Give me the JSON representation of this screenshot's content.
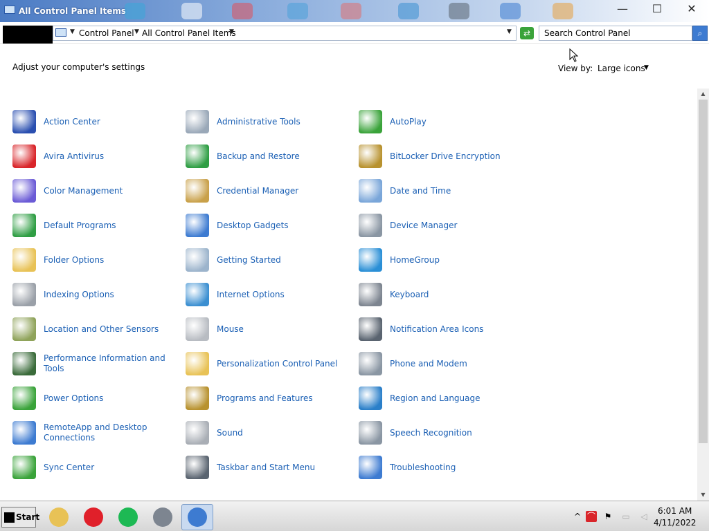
{
  "window": {
    "title": "All Control Panel Items",
    "controls": {
      "minimize": "—",
      "maximize": "☐",
      "close": "✕"
    }
  },
  "address": {
    "breadcrumb": [
      "Control Panel",
      "All Control Panel Items"
    ],
    "search_placeholder": "Search Control Panel"
  },
  "content": {
    "heading": "Adjust your computer's settings",
    "view_by_label": "View by:",
    "view_by_value": "Large icons",
    "items": [
      [
        {
          "label": "Action Center",
          "icon": "flag-icon",
          "color": "#2a4fb0"
        },
        {
          "label": "Administrative Tools",
          "icon": "tools-icon",
          "color": "#9aa8b8"
        },
        {
          "label": "AutoPlay",
          "icon": "autoplay-icon",
          "color": "#3aa33a"
        }
      ],
      [
        {
          "label": "Avira Antivirus",
          "icon": "avira-icon",
          "color": "#d9252a"
        },
        {
          "label": "Backup and Restore",
          "icon": "backup-icon",
          "color": "#2f9e44"
        },
        {
          "label": "BitLocker Drive Encryption",
          "icon": "bitlocker-icon",
          "color": "#b8922f"
        }
      ],
      [
        {
          "label": "Color Management",
          "icon": "color-icon",
          "color": "#6b5bd6"
        },
        {
          "label": "Credential Manager",
          "icon": "credential-icon",
          "color": "#c9a14a"
        },
        {
          "label": "Date and Time",
          "icon": "clock-icon",
          "color": "#7aa6d9"
        }
      ],
      [
        {
          "label": "Default Programs",
          "icon": "default-programs-icon",
          "color": "#2f9e44"
        },
        {
          "label": "Desktop Gadgets",
          "icon": "gadgets-icon",
          "color": "#3d7bd1"
        },
        {
          "label": "Device Manager",
          "icon": "device-manager-icon",
          "color": "#8a96a3"
        }
      ],
      [
        {
          "label": "Folder Options",
          "icon": "folder-icon",
          "color": "#e8c256"
        },
        {
          "label": "Getting Started",
          "icon": "getting-started-icon",
          "color": "#9cb4cc"
        },
        {
          "label": "HomeGroup",
          "icon": "homegroup-icon",
          "color": "#2a8fd6"
        }
      ],
      [
        {
          "label": "Indexing Options",
          "icon": "indexing-icon",
          "color": "#9aa0a8"
        },
        {
          "label": "Internet Options",
          "icon": "globe-icon",
          "color": "#3b8fd1"
        },
        {
          "label": "Keyboard",
          "icon": "keyboard-icon",
          "color": "#7d8590"
        }
      ],
      [
        {
          "label": "Location and Other Sensors",
          "icon": "sensor-icon",
          "color": "#8fa35a"
        },
        {
          "label": "Mouse",
          "icon": "mouse-icon",
          "color": "#b8bcc2"
        },
        {
          "label": "Notification Area Icons",
          "icon": "notification-icon",
          "color": "#5a6470"
        }
      ],
      [
        {
          "label": "Performance Information and Tools",
          "icon": "performance-icon",
          "color": "#3a6b3a"
        },
        {
          "label": "Personalization Control Panel",
          "icon": "personalization-icon",
          "color": "#e8c256"
        },
        {
          "label": "Phone and Modem",
          "icon": "phone-icon",
          "color": "#8a96a3"
        }
      ],
      [
        {
          "label": "Power Options",
          "icon": "power-icon",
          "color": "#3aa33a"
        },
        {
          "label": "Programs and Features",
          "icon": "programs-icon",
          "color": "#b8922f"
        },
        {
          "label": "Region and Language",
          "icon": "region-icon",
          "color": "#2a7fc9"
        }
      ],
      [
        {
          "label": "RemoteApp and Desktop Connections",
          "icon": "remoteapp-icon",
          "color": "#3d7bd1"
        },
        {
          "label": "Sound",
          "icon": "speaker-icon",
          "color": "#a9aeb5"
        },
        {
          "label": "Speech Recognition",
          "icon": "microphone-icon",
          "color": "#8a96a3"
        }
      ],
      [
        {
          "label": "Sync Center",
          "icon": "sync-icon",
          "color": "#3aa33a"
        },
        {
          "label": "Taskbar and Start Menu",
          "icon": "taskbar-icon",
          "color": "#5a6470"
        },
        {
          "label": "Troubleshooting",
          "icon": "troubleshooting-icon",
          "color": "#3d7bd1"
        }
      ]
    ]
  },
  "taskbar": {
    "start_label": "Start",
    "apps": [
      {
        "name": "file-explorer-icon",
        "color": "#e8c256"
      },
      {
        "name": "opera-icon",
        "color": "#e0202a"
      },
      {
        "name": "spotify-icon",
        "color": "#1db954"
      },
      {
        "name": "network-app-icon",
        "color": "#7d8590"
      },
      {
        "name": "control-panel-icon",
        "color": "#3d7bd1"
      }
    ],
    "time": "6:01 AM",
    "date": "4/11/2022"
  }
}
